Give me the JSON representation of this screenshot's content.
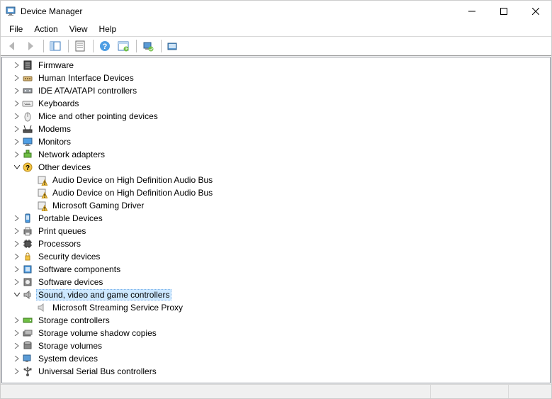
{
  "window": {
    "title": "Device Manager"
  },
  "menu": {
    "items": [
      "File",
      "Action",
      "View",
      "Help"
    ]
  },
  "toolbar": {
    "buttons": [
      {
        "name": "back",
        "disabled": true
      },
      {
        "name": "forward",
        "disabled": true
      },
      {
        "name": "sep"
      },
      {
        "name": "show-hide-tree"
      },
      {
        "name": "sep"
      },
      {
        "name": "properties"
      },
      {
        "name": "sep"
      },
      {
        "name": "help"
      },
      {
        "name": "update-driver"
      },
      {
        "name": "sep"
      },
      {
        "name": "scan-hardware"
      },
      {
        "name": "sep"
      },
      {
        "name": "add-legacy"
      }
    ]
  },
  "tree": {
    "nodes": [
      {
        "label": "Firmware",
        "icon": "firmware",
        "state": "collapsed",
        "level": 0,
        "selected": false
      },
      {
        "label": "Human Interface Devices",
        "icon": "hid",
        "state": "collapsed",
        "level": 0,
        "selected": false
      },
      {
        "label": "IDE ATA/ATAPI controllers",
        "icon": "ide",
        "state": "collapsed",
        "level": 0,
        "selected": false
      },
      {
        "label": "Keyboards",
        "icon": "keyboard",
        "state": "collapsed",
        "level": 0,
        "selected": false
      },
      {
        "label": "Mice and other pointing devices",
        "icon": "mouse",
        "state": "collapsed",
        "level": 0,
        "selected": false
      },
      {
        "label": "Modems",
        "icon": "modem",
        "state": "collapsed",
        "level": 0,
        "selected": false
      },
      {
        "label": "Monitors",
        "icon": "monitor",
        "state": "collapsed",
        "level": 0,
        "selected": false
      },
      {
        "label": "Network adapters",
        "icon": "network",
        "state": "collapsed",
        "level": 0,
        "selected": false
      },
      {
        "label": "Other devices",
        "icon": "other",
        "state": "expanded",
        "level": 0,
        "selected": false
      },
      {
        "label": "Audio Device on High Definition Audio Bus",
        "icon": "warn",
        "state": "none",
        "level": 1,
        "selected": false
      },
      {
        "label": "Audio Device on High Definition Audio Bus",
        "icon": "warn",
        "state": "none",
        "level": 1,
        "selected": false
      },
      {
        "label": "Microsoft Gaming Driver",
        "icon": "warn",
        "state": "none",
        "level": 1,
        "selected": false
      },
      {
        "label": "Portable Devices",
        "icon": "portable",
        "state": "collapsed",
        "level": 0,
        "selected": false
      },
      {
        "label": "Print queues",
        "icon": "printer",
        "state": "collapsed",
        "level": 0,
        "selected": false
      },
      {
        "label": "Processors",
        "icon": "cpu",
        "state": "collapsed",
        "level": 0,
        "selected": false
      },
      {
        "label": "Security devices",
        "icon": "security",
        "state": "collapsed",
        "level": 0,
        "selected": false
      },
      {
        "label": "Software components",
        "icon": "swcomp",
        "state": "collapsed",
        "level": 0,
        "selected": false
      },
      {
        "label": "Software devices",
        "icon": "swdev",
        "state": "collapsed",
        "level": 0,
        "selected": false
      },
      {
        "label": "Sound, video and game controllers",
        "icon": "sound",
        "state": "expanded",
        "level": 0,
        "selected": true
      },
      {
        "label": "Microsoft Streaming Service Proxy",
        "icon": "speaker",
        "state": "none",
        "level": 1,
        "selected": false
      },
      {
        "label": "Storage controllers",
        "icon": "storagectl",
        "state": "collapsed",
        "level": 0,
        "selected": false
      },
      {
        "label": "Storage volume shadow copies",
        "icon": "shadow",
        "state": "collapsed",
        "level": 0,
        "selected": false
      },
      {
        "label": "Storage volumes",
        "icon": "storagevol",
        "state": "collapsed",
        "level": 0,
        "selected": false
      },
      {
        "label": "System devices",
        "icon": "system",
        "state": "collapsed",
        "level": 0,
        "selected": false
      },
      {
        "label": "Universal Serial Bus controllers",
        "icon": "usb",
        "state": "collapsed",
        "level": 0,
        "selected": false
      }
    ]
  }
}
